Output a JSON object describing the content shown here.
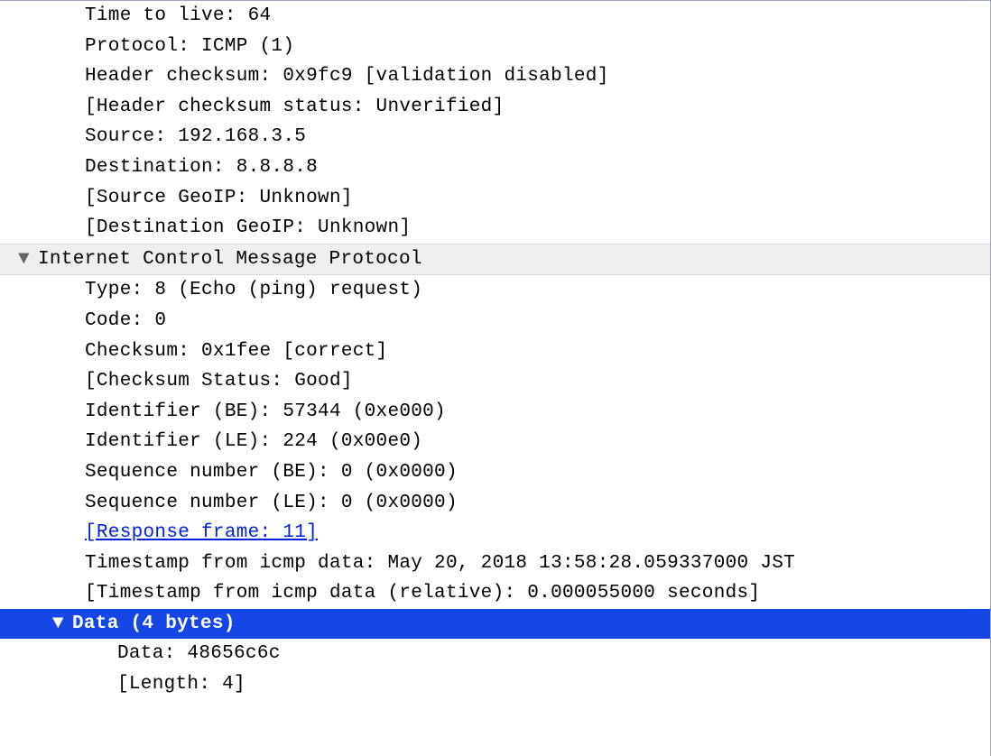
{
  "ip_fields": {
    "ttl": "Time to live: 64",
    "protocol": "Protocol: ICMP (1)",
    "header_checksum": "Header checksum: 0x9fc9 [validation disabled]",
    "header_checksum_status": "[Header checksum status: Unverified]",
    "source": "Source: 192.168.3.5",
    "destination": "Destination: 8.8.8.8",
    "source_geoip": "[Source GeoIP: Unknown]",
    "destination_geoip": "[Destination GeoIP: Unknown]"
  },
  "icmp_header": "Internet Control Message Protocol",
  "icmp_fields": {
    "type": "Type: 8 (Echo (ping) request)",
    "code": "Code: 0",
    "checksum": "Checksum: 0x1fee [correct]",
    "checksum_status": "[Checksum Status: Good]",
    "identifier_be": "Identifier (BE): 57344 (0xe000)",
    "identifier_le": "Identifier (LE): 224 (0x00e0)",
    "seq_be": "Sequence number (BE): 0 (0x0000)",
    "seq_le": "Sequence number (LE): 0 (0x0000)",
    "response_frame": "[Response frame: 11]",
    "timestamp": "Timestamp from icmp data: May 20, 2018 13:58:28.059337000 JST",
    "timestamp_relative": "[Timestamp from icmp data (relative): 0.000055000 seconds]"
  },
  "data_header": "Data (4 bytes)",
  "data_fields": {
    "data": "Data: 48656c6c",
    "length": "[Length: 4]"
  }
}
